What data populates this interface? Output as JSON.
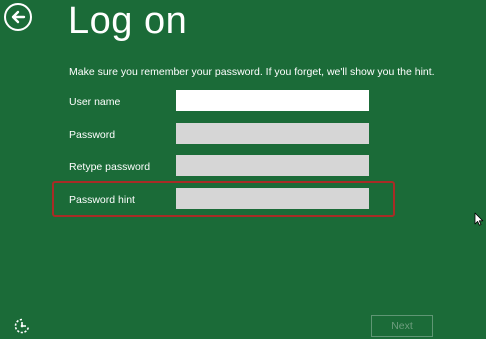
{
  "header": {
    "title": "Log on",
    "back_icon": "back-arrow-icon"
  },
  "instructions": "Make sure you remember your password. If you forget, we'll show you the hint.",
  "form": {
    "fields": [
      {
        "label": "User name",
        "value": "",
        "state": "enabled"
      },
      {
        "label": "Password",
        "value": "",
        "state": "disabled"
      },
      {
        "label": "Retype password",
        "value": "",
        "state": "disabled"
      },
      {
        "label": "Password hint",
        "value": "",
        "state": "disabled"
      }
    ]
  },
  "footer": {
    "next_label": "Next",
    "next_state": "disabled",
    "ease_of_access_icon": "ease-of-access-icon"
  },
  "colors": {
    "background": "#1b6b38",
    "highlight": "#a82c26",
    "field_active": "#ffffff",
    "field_inactive": "#d6d6d6"
  }
}
